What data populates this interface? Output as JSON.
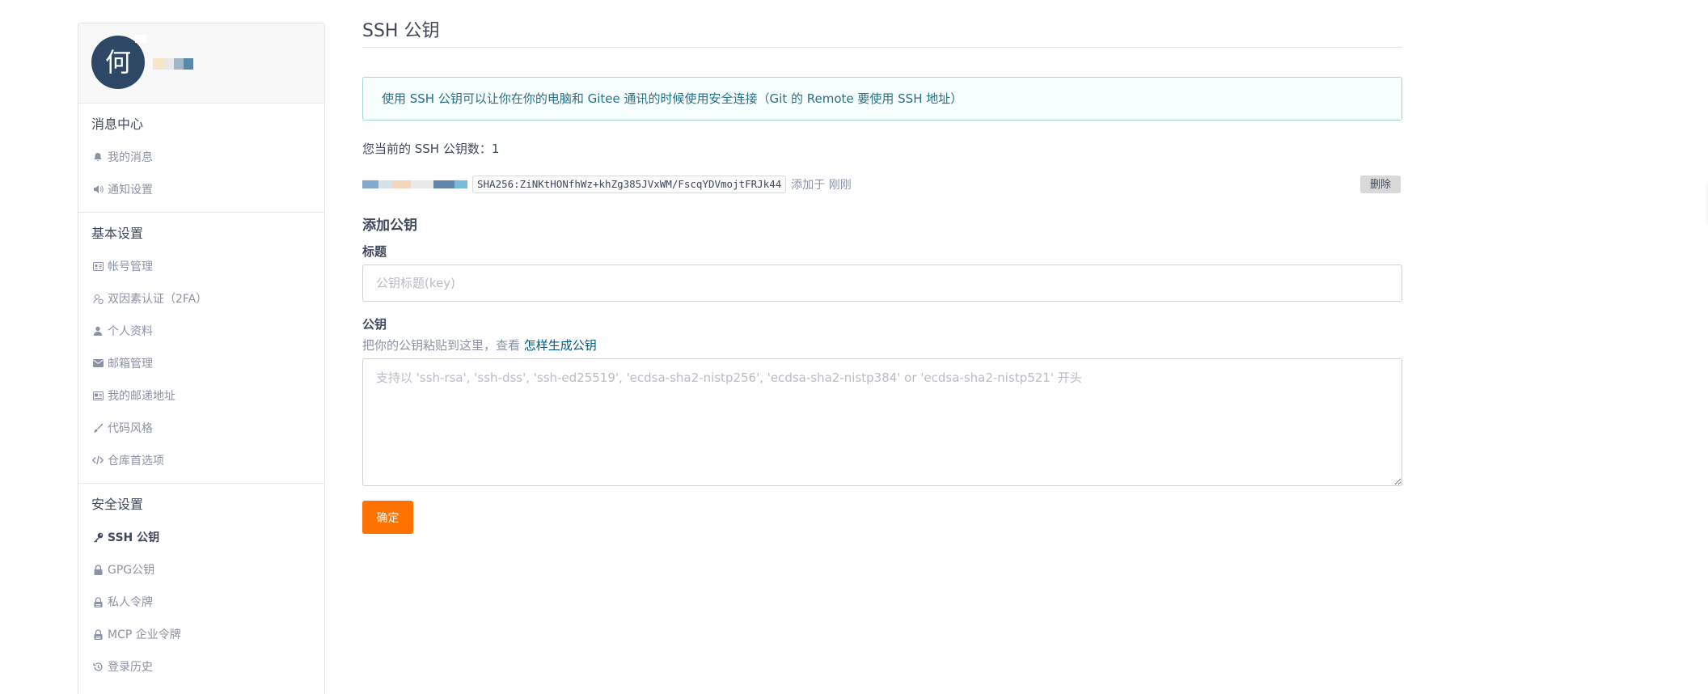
{
  "profile": {
    "avatar_letter": "何",
    "username": "何**",
    "username_blur_colors": [
      "#f5e6c8",
      "#e8e8e8",
      "#9fb7c6",
      "#5a89a8"
    ]
  },
  "sidebar": {
    "sections": [
      {
        "title": "消息中心",
        "items": [
          {
            "label": "我的消息",
            "icon": "bell-icon"
          },
          {
            "label": "通知设置",
            "icon": "volume-icon"
          }
        ]
      },
      {
        "title": "基本设置",
        "items": [
          {
            "label": "帐号管理",
            "icon": "id-card-icon"
          },
          {
            "label": "双因素认证（2FA）",
            "icon": "user-shield-icon"
          },
          {
            "label": "个人资料",
            "icon": "user-icon"
          },
          {
            "label": "邮箱管理",
            "icon": "envelope-icon"
          },
          {
            "label": "我的邮递地址",
            "icon": "address-card-icon"
          },
          {
            "label": "代码风格",
            "icon": "brush-icon"
          },
          {
            "label": "仓库首选项",
            "icon": "code-icon"
          }
        ]
      },
      {
        "title": "安全设置",
        "items": [
          {
            "label": "SSH 公钥",
            "icon": "key-icon",
            "active": true
          },
          {
            "label": "GPG公钥",
            "icon": "lock-icon"
          },
          {
            "label": "私人令牌",
            "icon": "token-icon"
          },
          {
            "label": "MCP 企业令牌",
            "icon": "token-icon"
          },
          {
            "label": "登录历史",
            "icon": "history-icon"
          }
        ]
      }
    ]
  },
  "main": {
    "title": "SSH 公钥",
    "info": "使用 SSH 公钥可以让你在你的电脑和 Gitee 通讯的时候使用安全连接（Git 的 Remote 要使用 SSH 地址）",
    "key_count_label": "您当前的 SSH 公钥数：",
    "key_count": "1",
    "keys": [
      {
        "fingerprint": "SHA256:ZiNKtHONfhWz+khZg385JVxWM/FscqYDVmojtFRJk44",
        "added": "添加于 刚刚",
        "name_blur_colors": [
          "#5b8fbf",
          "#c9d6e2",
          "#f0c9a4",
          "#e2e2e2",
          "#2e5e8e",
          "#4aa3cf"
        ]
      }
    ],
    "delete_label": "删除",
    "add_title": "添加公钥",
    "title_label": "标题",
    "title_placeholder": "公钥标题(key)",
    "title_value": "",
    "key_label": "公钥",
    "hint_text": "把你的公钥粘贴到这里，查看 ",
    "hint_link": "怎样生成公钥",
    "key_placeholder": "支持以 'ssh-rsa', 'ssh-dss', 'ssh-ed25519', 'ecdsa-sha2-nistp256', 'ecdsa-sha2-nistp384' or 'ecdsa-sha2-nistp521' 开头",
    "key_value": "",
    "submit_label": "确定"
  },
  "colors": {
    "accent": "#fe7300",
    "link": "#005980",
    "info_text": "#276f86",
    "info_border": "#a9d5de",
    "avatar_bg": "#2d4765"
  }
}
